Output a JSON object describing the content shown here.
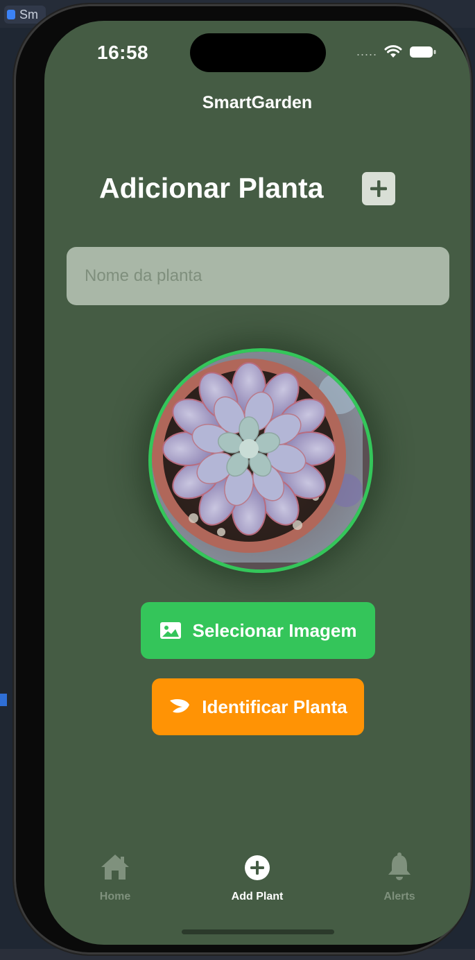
{
  "background_window": {
    "tab_label": "Sm"
  },
  "status_bar": {
    "time": "16:58",
    "signal": "....."
  },
  "header": {
    "app_title": "SmartGarden"
  },
  "page": {
    "title": "Adicionar Planta"
  },
  "form": {
    "name_placeholder": "Nome da planta",
    "name_value": ""
  },
  "buttons": {
    "select_image": "Selecionar Imagem",
    "identify_plant": "Identificar Planta"
  },
  "tab_bar": {
    "items": [
      {
        "label": "Home",
        "icon": "home-icon",
        "active": false
      },
      {
        "label": "Add Plant",
        "icon": "plus-circle-icon",
        "active": true
      },
      {
        "label": "Alerts",
        "icon": "bell-icon",
        "active": false
      }
    ]
  },
  "colors": {
    "screen_bg": "#455c44",
    "accent_green": "#34c55a",
    "accent_orange": "#ff9305",
    "input_bg": "#a9b7a7",
    "inactive_tab": "#7f917d"
  }
}
